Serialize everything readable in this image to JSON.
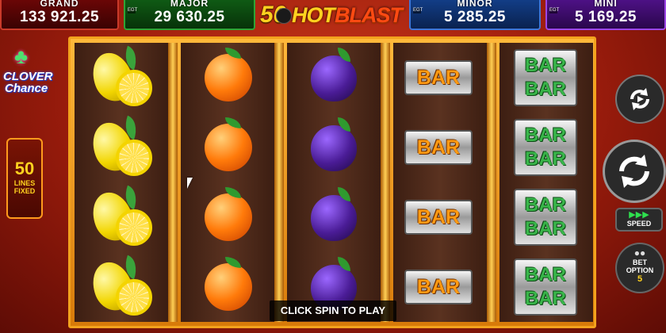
{
  "jackpots": {
    "grand": {
      "name": "GRAND",
      "value": "133 921.25"
    },
    "major": {
      "name": "MAJOR",
      "value": "29 630.25"
    },
    "minor": {
      "name": "MINOR",
      "value": "5 285.25"
    },
    "mini": {
      "name": "MINI",
      "value": "5 169.25"
    },
    "egt_label": "EGT"
  },
  "logo": {
    "number": "50",
    "word1": "HOT",
    "word2": "BLAST"
  },
  "side": {
    "clover_line1": "CLOVER",
    "clover_line2": "Chance",
    "lines_count": "50",
    "lines_label1": "LINES",
    "lines_label2": "FIXED"
  },
  "reels": [
    [
      "lemon",
      "lemon",
      "lemon",
      "lemon"
    ],
    [
      "orange",
      "orange",
      "orange",
      "orange"
    ],
    [
      "plum",
      "plum",
      "plum",
      "plum"
    ],
    [
      "bar",
      "bar",
      "bar",
      "bar"
    ],
    [
      "bar-bar",
      "bar-bar",
      "bar-bar",
      "bar-bar"
    ]
  ],
  "symbol_text": {
    "bar": "BAR"
  },
  "controls": {
    "speed_label": "SPEED",
    "bet_option_line1": "BET",
    "bet_option_line2": "OPTION",
    "bet_option_value": "5"
  },
  "message": "CLICK SPIN TO PLAY",
  "colors": {
    "frame": "#f2a21d",
    "background": "#b8280f",
    "grand": "#c93a2a",
    "major": "#2fa335",
    "minor": "#3f76d6",
    "mini": "#9c46e6"
  }
}
